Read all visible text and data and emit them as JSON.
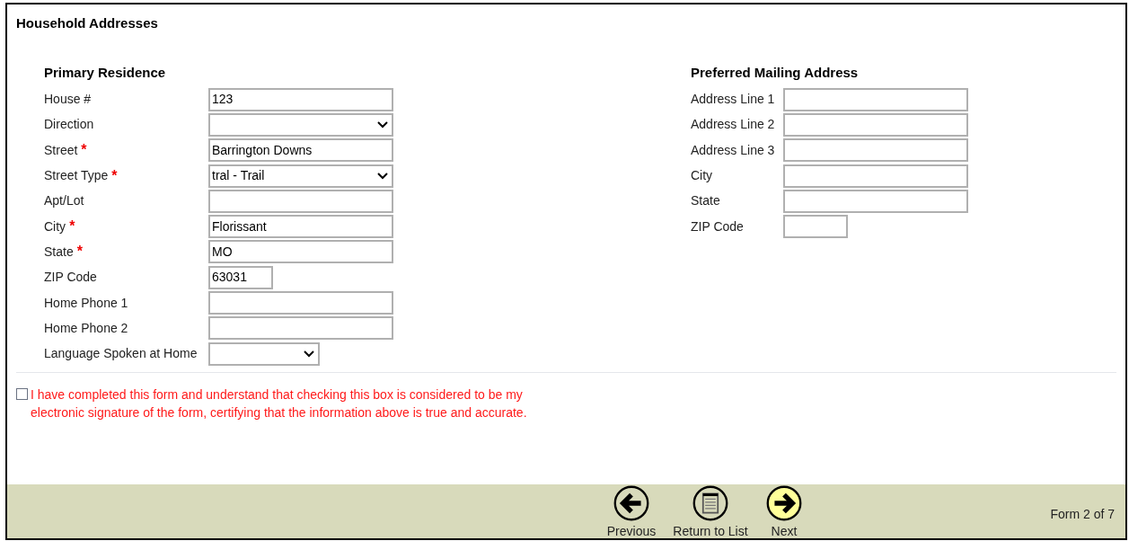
{
  "title": "Household Addresses",
  "sections": [
    {
      "title": "Primary Residence",
      "fields": [
        {
          "label": "House #",
          "kind": "text",
          "value": "123"
        },
        {
          "label": "Direction",
          "kind": "select"
        },
        {
          "label": "Street",
          "required_mark": "*",
          "kind": "text",
          "value": "Barrington Downs"
        },
        {
          "label": "Street Type",
          "required_mark": "*",
          "kind": "select",
          "value": "tral - Trail"
        },
        {
          "label": "Apt/Lot",
          "kind": "text"
        },
        {
          "label": "City",
          "required_mark": "*",
          "kind": "text",
          "value": "Florissant"
        },
        {
          "label": "State",
          "required_mark": "*",
          "kind": "text",
          "value": "MO"
        },
        {
          "label": "ZIP Code",
          "kind": "short_text",
          "value": "63031"
        },
        {
          "label": "Home Phone 1",
          "kind": "text"
        },
        {
          "label": "Home Phone 2",
          "kind": "text"
        },
        {
          "label": "Language Spoken at Home",
          "kind": "short_select"
        }
      ]
    },
    {
      "title": "Preferred Mailing Address",
      "fields": [
        {
          "label": "Address Line 1",
          "kind": "text"
        },
        {
          "label": "Address Line 2",
          "kind": "text"
        },
        {
          "label": "Address Line 3",
          "kind": "text"
        },
        {
          "label": "City",
          "kind": "text"
        },
        {
          "label": "State",
          "kind": "text"
        },
        {
          "label": "ZIP Code",
          "kind": "short_text"
        }
      ]
    }
  ],
  "certification": {
    "checked": false,
    "text": "I have completed this form and understand that checking this box is considered to be my electronic signature of the form, certifying that the information above is true and accurate."
  },
  "footer": {
    "buttons": [
      {
        "kind": "previous",
        "label": "Previous",
        "highlighted": false
      },
      {
        "kind": "list",
        "label": "Return to List",
        "highlighted": false
      },
      {
        "kind": "next",
        "label": "Next",
        "highlighted": true
      }
    ],
    "page_indicator": "Form 2 of 7"
  }
}
